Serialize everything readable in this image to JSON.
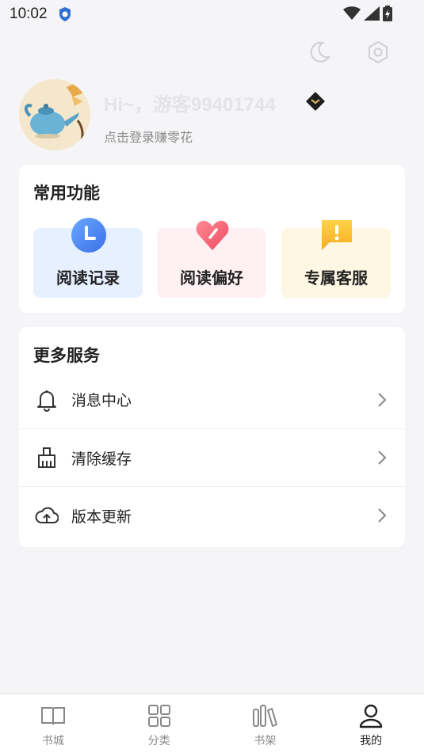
{
  "status": {
    "time": "10:02"
  },
  "profile": {
    "username": "Hi~，游客99401744",
    "login_hint": "点击登录赚零花"
  },
  "common": {
    "title": "常用功能",
    "items": [
      {
        "label": "阅读记录",
        "icon": "clock-icon"
      },
      {
        "label": "阅读偏好",
        "icon": "heart-icon"
      },
      {
        "label": "专属客服",
        "icon": "chat-alert-icon"
      }
    ]
  },
  "more": {
    "title": "更多服务",
    "items": [
      {
        "label": "消息中心",
        "icon": "bell-icon"
      },
      {
        "label": "清除缓存",
        "icon": "broom-icon"
      },
      {
        "label": "版本更新",
        "icon": "cloud-upload-icon"
      }
    ]
  },
  "tabs": [
    {
      "label": "书城",
      "icon": "book-open-icon",
      "active": false
    },
    {
      "label": "分类",
      "icon": "grid-icon",
      "active": false
    },
    {
      "label": "书架",
      "icon": "bookshelf-icon",
      "active": false
    },
    {
      "label": "我的",
      "icon": "user-icon",
      "active": true
    }
  ],
  "colors": {
    "background": "#f5f5f7",
    "card": "#ffffff",
    "feat_blue_bg": "#e6f0ff",
    "feat_pink_bg": "#fff1f3",
    "feat_yellow_bg": "#fdf7e3",
    "username_color": "#e4e4e6"
  }
}
